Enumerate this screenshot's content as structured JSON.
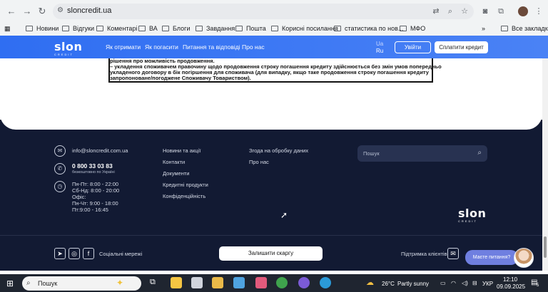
{
  "browser": {
    "url": "sloncredit.ua",
    "bookmarks": [
      "Новини",
      "Відгуки",
      "Коментарі",
      "ВА",
      "Блоги",
      "Завдання",
      "Пошта",
      "Корисні посилання",
      "статистика по нов...",
      "МФО"
    ],
    "all_bookmarks": "Все закладки"
  },
  "header": {
    "logo": "slon",
    "logo_sub": "CREDIT",
    "nav": [
      "Як отримати",
      "Як погасити",
      "Питання та відповіді",
      "Про нас"
    ],
    "lang_active": "Ua",
    "lang_other": "Ru",
    "login": "Увійти",
    "pay": "Сплатити кредит"
  },
  "document": {
    "lines": [
      "рішення про можливість продовження.",
      "– укладення споживачем правочину щодо продовження строку погашення кредиту здійснюється без змін умов попередньо",
      "укладеного договору в бік погіршення для споживача (для випадку, якщо таке продовження строку погашення кредиту",
      "запропоноване/погоджене  Споживачу Товариством)."
    ]
  },
  "footer": {
    "email": "info@sloncredit.com.ua",
    "phone": "0 800 33 03 83",
    "phone_note": "безкоштовно по Україні",
    "hours": [
      "Пн-Пт: 8:00 - 22:00",
      "Сб-Нд: 8:00 - 20:00",
      "Офіс:",
      "Пн-Чт: 9:00 - 18:00",
      "Пт:9:00 - 16:45"
    ],
    "links_col1": [
      "Новини та акції",
      "Контакти",
      "Документи",
      "Кредитні продукти",
      "Конфіденційність"
    ],
    "links_col2": [
      "Згода на обробку даних",
      "Про нас"
    ],
    "search_placeholder": "Пошук",
    "social_label": "Соціальні мережі",
    "complaint": "Залишити скаргу",
    "support_label": "Підтримка клієнтів",
    "chat": "Маєте питання?",
    "logo": "slon",
    "logo_sub": "CREDIT"
  },
  "taskbar": {
    "search": "Пошук",
    "weather_temp": "26°C",
    "weather_desc": "Partly sunny",
    "lang": "УКР",
    "time": "12:10",
    "date": "09.09.2025",
    "notifications": "5"
  }
}
